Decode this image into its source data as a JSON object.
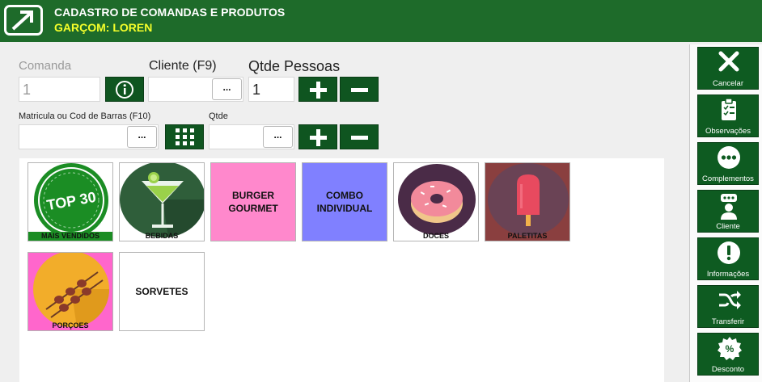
{
  "header": {
    "title": "CADASTRO DE COMANDAS E PRODUTOS",
    "waiter": "GARÇOM: LOREN",
    "logo_icon": "arrow-logo-icon"
  },
  "form": {
    "comanda_label": "Comanda",
    "comanda_value": "1",
    "info_icon": "info-icon",
    "cliente_label": "Cliente (F9)",
    "cliente_value": "",
    "lookup_label": "...",
    "qtde_pessoas_label": "Qtde Pessoas",
    "qtde_pessoas_value": "1",
    "plus_icon": "plus-icon",
    "minus_icon": "minus-icon",
    "matricula_label": "Matricula ou Cod de Barras (F10)",
    "matricula_value": "",
    "grid_icon": "keypad-grid-icon",
    "qtde_label": "Qtde",
    "qtde_value": ""
  },
  "categories": [
    {
      "label": "MAIS VENDIDOS",
      "badge": "TOP 30",
      "icon": "top30-stamp-icon",
      "bg": "#ffffff",
      "caption_bg": "#1b8d24"
    },
    {
      "label": "BEBIDAS",
      "icon": "cocktail-glass-icon",
      "bg": "#ffffff"
    },
    {
      "label": "BURGER\nGOURMET",
      "bg": "#ff88cc"
    },
    {
      "label": "COMBO\nINDIVIDUAL",
      "bg": "#8080ff"
    },
    {
      "label": "DOCES",
      "icon": "donut-icon",
      "bg": "#ffffff"
    },
    {
      "label": "PALETITAS",
      "icon": "popsicle-icon",
      "bg": "#8a3f3f"
    },
    {
      "label": "PORÇOES",
      "icon": "skewer-icon",
      "bg": "#ff66cc"
    },
    {
      "label": "SORVETES",
      "bg": "#ffffff"
    }
  ],
  "sidebar": [
    {
      "label": "Cancelar",
      "icon": "close-icon"
    },
    {
      "label": "Observações",
      "icon": "clipboard-checklist-icon"
    },
    {
      "label": "Complementos",
      "icon": "more-dots-icon"
    },
    {
      "label": "Cliente",
      "icon": "user-icon"
    },
    {
      "label": "Informações",
      "icon": "exclamation-icon"
    },
    {
      "label": "Transferir",
      "icon": "shuffle-icon"
    },
    {
      "label": "Desconto",
      "icon": "discount-badge-icon"
    }
  ],
  "colors": {
    "header_bg": "#1e6b2a",
    "waiter_text": "#f5ff2a",
    "button_green": "#0f5520"
  }
}
